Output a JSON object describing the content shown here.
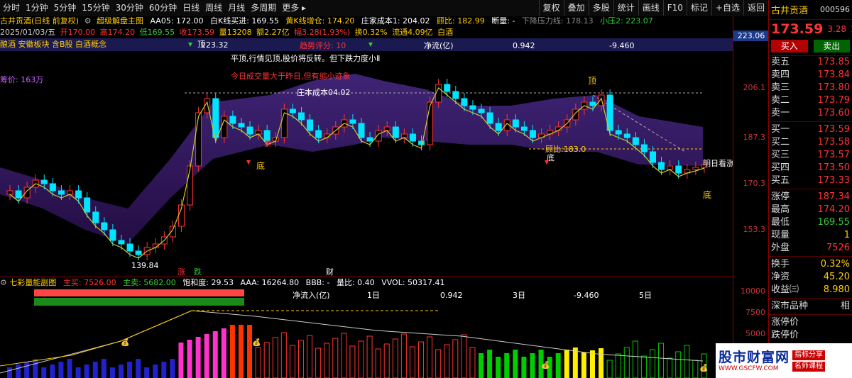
{
  "toolbar": {
    "left_items": [
      "分时",
      "1分钟",
      "5分钟",
      "15分钟",
      "30分钟",
      "60分钟",
      "日线",
      "周线",
      "月线",
      "多周期",
      "更多 ▸"
    ],
    "right_items": [
      "复权",
      "叠加",
      "多股",
      "统计",
      "画线",
      "F10",
      "标记",
      "+自选",
      "返回"
    ]
  },
  "info_line1": {
    "stock": "古井贡酒(日线 前复权)",
    "indicator_name": "超级解盘主图",
    "aa05": "AA05: 172.00",
    "white_k": "白K线买进: 169.55",
    "yellow_k": "黄K线增仓: 174.20",
    "cost": "庄家成本1: 204.02",
    "top_ratio": "顾比: 182.99",
    "duanmian": "断量: -",
    "pressure": "下降压力线: 178.13",
    "small_pressure": "小压2: 223.07"
  },
  "info_line2": {
    "date": "2025/01/03/五",
    "open": "开170.00",
    "high": "高174.20",
    "low": "低169.55",
    "close": "收173.59",
    "vol": "量13208",
    "amount": "额2.27亿",
    "range": "幅3.28(1.93%)",
    "turnover": "换0.32%",
    "float": "流通4.09亿",
    "concept": "白酒"
  },
  "main_annotations": {
    "concept_tags": "酿酒 安徽板块 含B股 白酒概念",
    "avg_price": "筹价: 163万",
    "top_label": "平顶,行情见顶,股价将反转。但下跌力度小Ⅱ",
    "vol_note": "今日成交量大于昨日,但有缩小迹象",
    "cost_label": "庄本成本04.02",
    "trend_score": "趋势评分: 10",
    "net_flow_label": "净流(亿)",
    "net_flow_1": "0.942",
    "net_flow_2": "-9.460",
    "high_mark": "223.32",
    "low_mark": "139.84",
    "top_mark_1": "顶",
    "top_mark_2": "顶",
    "bottom_mark_1": "底",
    "bottom_mark_2": "底",
    "bottom_mark_3": "底",
    "sell_mark": "卖",
    "gubi": "顾比:183.0",
    "tomorrow": "明日看涨",
    "zhang": "涨",
    "die": "跌",
    "cai": "财"
  },
  "axis": {
    "current": "223.06",
    "ticks": [
      "206.1",
      "187.3",
      "170.3",
      "153.3"
    ],
    "sub_ticks": [
      "10000",
      "7500",
      "5000"
    ]
  },
  "sub_info": {
    "title": "七彩量能副图",
    "main_buy": "主买: 7526.00",
    "main_sell": "主卖: 5682.00",
    "saturation": "饱和度: 29.53",
    "aaa": "AAA: 16264.80",
    "bbb": "BBB: -",
    "ratio": "量比: 0.40",
    "vvol": "VVOL: 50317.41",
    "net_in_label": "净流入(亿)",
    "day1": "1日",
    "net1": "0.942",
    "day3": "3日",
    "net3": "-9.460",
    "day5": "5日"
  },
  "panel": {
    "name": "古井贡酒",
    "code": "000596",
    "price": "173.59",
    "change": "3.28",
    "change_extra": "1",
    "buy_label": "买入",
    "sell_label": "卖出",
    "sells": [
      {
        "label": "卖五",
        "price": "173.85",
        "vol": ""
      },
      {
        "label": "卖四",
        "price": "173.84",
        "vol": ""
      },
      {
        "label": "卖三",
        "price": "173.80",
        "vol": ""
      },
      {
        "label": "卖二",
        "price": "173.79",
        "vol": ""
      },
      {
        "label": "卖一",
        "price": "173.60",
        "vol": ""
      }
    ],
    "buys": [
      {
        "label": "买一",
        "price": "173.59",
        "vol": ""
      },
      {
        "label": "买二",
        "price": "173.58",
        "vol": ""
      },
      {
        "label": "买三",
        "price": "173.57",
        "vol": ""
      },
      {
        "label": "买四",
        "price": "173.50",
        "vol": ""
      },
      {
        "label": "买五",
        "price": "173.33",
        "vol": ""
      }
    ],
    "stats1": [
      {
        "label": "涨停",
        "value": "187.34",
        "color": "#ff3333"
      },
      {
        "label": "最高",
        "value": "174.20",
        "color": "#ff3333"
      },
      {
        "label": "最低",
        "value": "169.55",
        "color": "#33cc33"
      },
      {
        "label": "现量",
        "value": "1",
        "color": "#ffcc00"
      },
      {
        "label": "外盘",
        "value": "7526",
        "color": "#ff3333"
      }
    ],
    "stats2": [
      {
        "label": "换手",
        "value": "0.32%",
        "color": "#ffcc00"
      },
      {
        "label": "净资",
        "value": "45.20",
        "color": "#ffcc00"
      },
      {
        "label": "收益㈢",
        "value": "8.980",
        "color": "#ffcc00"
      }
    ],
    "sector_title": "深市品种",
    "sector_extra": "相",
    "limit_up_label": "涨停价",
    "limit_down_label": "跌停价"
  },
  "watermark": {
    "title": "股市财富网",
    "url": "WWW.GSCFW.COM",
    "tag1": "指标分享",
    "tag2": "名师课程"
  },
  "colors": {
    "up": "#ff3333",
    "down": "#00e5ff",
    "ma": "#ffcc00",
    "bg_band": "#3a1a6a"
  }
}
